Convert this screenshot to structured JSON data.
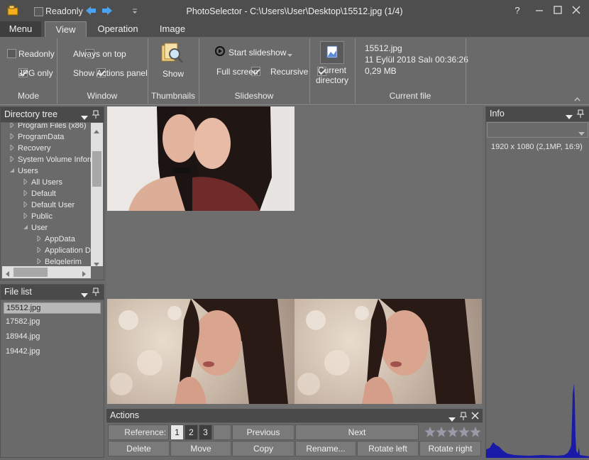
{
  "titlebar": {
    "readonly_label": "Readonly",
    "title": "PhotoSelector - C:\\Users\\User\\Desktop\\15512.jpg (1/4)",
    "help": "?"
  },
  "tabs": [
    "Menu",
    "View",
    "Operation",
    "Image"
  ],
  "ribbon": {
    "mode": {
      "readonly": "Readonly",
      "jpg_only": "JPG only",
      "label": "Mode"
    },
    "window": {
      "always_on_top": "Always on top",
      "show_actions": "Show Actions panel",
      "label": "Window"
    },
    "thumbnails": {
      "show": "Show",
      "label": "Thumbnails"
    },
    "slideshow": {
      "start": "Start slideshow",
      "full_screen": "Full screen",
      "recursive": "Recursive",
      "label": "Slideshow"
    },
    "current_directory": {
      "line1": "Current",
      "line2": "directory"
    },
    "current_file": {
      "name": "15512.jpg",
      "date": "11 Eylül 2018 Salı 00:36:26",
      "size": "0,29 MB",
      "label": "Current file"
    }
  },
  "directory_tree": {
    "title": "Directory tree",
    "items": [
      {
        "label": "Program Files (x86)",
        "level": 1,
        "open": false
      },
      {
        "label": "ProgramData",
        "level": 1,
        "open": false
      },
      {
        "label": "Recovery",
        "level": 1,
        "open": false
      },
      {
        "label": "System Volume Information",
        "level": 1,
        "open": false
      },
      {
        "label": "Users",
        "level": 1,
        "open": true
      },
      {
        "label": "All Users",
        "level": 2,
        "open": false
      },
      {
        "label": "Default",
        "level": 2,
        "open": false
      },
      {
        "label": "Default User",
        "level": 2,
        "open": false
      },
      {
        "label": "Public",
        "level": 2,
        "open": false
      },
      {
        "label": "User",
        "level": 2,
        "open": true
      },
      {
        "label": "AppData",
        "level": 3,
        "open": false
      },
      {
        "label": "Application Data",
        "level": 3,
        "open": false
      },
      {
        "label": "Belgelerim",
        "level": 3,
        "open": false
      }
    ]
  },
  "file_list": {
    "title": "File list",
    "files": [
      "15512.jpg",
      "17582.jpg",
      "18944.jpg",
      "19442.jpg"
    ]
  },
  "info": {
    "title": "Info",
    "resolution": "1920 x 1080 (2,1MP, 16:9)"
  },
  "actions": {
    "title": "Actions",
    "reference_label": "Reference:",
    "references": [
      "1",
      "2",
      "3"
    ],
    "previous": "Previous",
    "next": "Next",
    "delete": "Delete",
    "move": "Move",
    "copy": "Copy",
    "rename": "Rename...",
    "rotate_left": "Rotate left",
    "rotate_right": "Rotate right",
    "rating": 0
  },
  "colors": {
    "accent": "#4aa3f0",
    "histogram": "#1a1aa8"
  }
}
